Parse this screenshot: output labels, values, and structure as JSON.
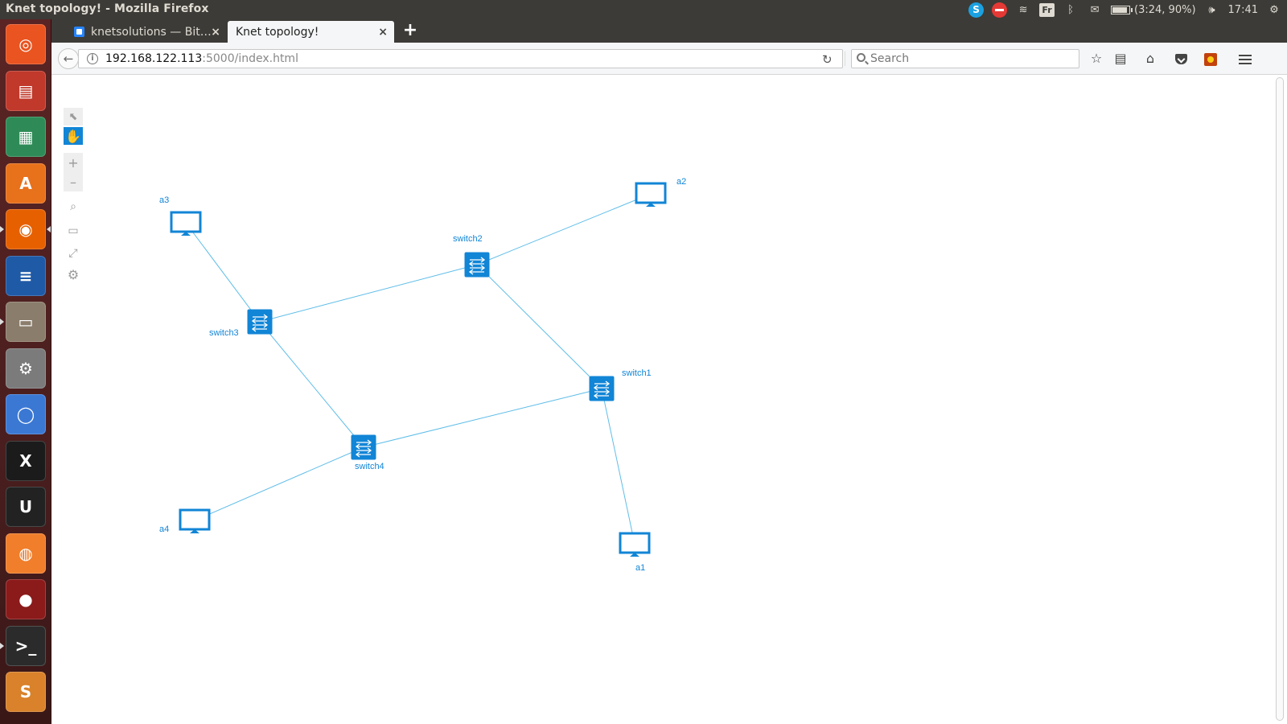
{
  "os_panel": {
    "window_title": "Knet topology! - Mozilla Firefox",
    "tray": {
      "skype_icon": "skype-icon",
      "keyboard_layout": "Fr",
      "battery_text": "(3:24, 90%)",
      "clock": "17:41"
    }
  },
  "launcher": {
    "items": [
      {
        "name": "ubuntu-dash-icon",
        "color": "#e95420",
        "glyph": "◎"
      },
      {
        "name": "impress-icon",
        "color": "#c0392b",
        "glyph": "▤"
      },
      {
        "name": "calc-icon",
        "color": "#2e8b57",
        "glyph": "▦"
      },
      {
        "name": "software-center-icon",
        "color": "#e8711b",
        "glyph": "A"
      },
      {
        "name": "firefox-icon",
        "color": "#e66000",
        "glyph": "◉"
      },
      {
        "name": "writer-icon",
        "color": "#1f5aa6",
        "glyph": "≡"
      },
      {
        "name": "files-icon",
        "color": "#8a7d6b",
        "glyph": "▭"
      },
      {
        "name": "system-settings-icon",
        "color": "#7b7b7b",
        "glyph": "⚙"
      },
      {
        "name": "chromium-icon",
        "color": "#3b78d4",
        "glyph": "◯"
      },
      {
        "name": "xchat-icon",
        "color": "#1b1b1b",
        "glyph": "X"
      },
      {
        "name": "uble-icon",
        "color": "#222222",
        "glyph": "U"
      },
      {
        "name": "blender-icon",
        "color": "#f07e2b",
        "glyph": "◍"
      },
      {
        "name": "red-app-icon",
        "color": "#8b1a1a",
        "glyph": "●"
      },
      {
        "name": "terminal-icon",
        "color": "#2b2b2b",
        "glyph": ">_"
      },
      {
        "name": "sublime-icon",
        "color": "#d9822b",
        "glyph": "S"
      }
    ]
  },
  "browser": {
    "tabs": [
      {
        "label": "knetsolutions — Bit…",
        "active": false
      },
      {
        "label": "Knet topology!",
        "active": true
      }
    ],
    "url_host": "192.168.122.113",
    "url_rest": ":5000/index.html",
    "search_placeholder": "Search"
  },
  "topology": {
    "toolbar": [
      "select-tool-icon",
      "pan-tool-icon",
      "zoom-in-icon",
      "zoom-out-icon",
      "zoom-by-selection-icon",
      "fit-to-screen-icon",
      "fullscreen-icon",
      "settings-gear-icon"
    ],
    "colors": {
      "node": "#1185d6",
      "link": "#5fbde8"
    },
    "nodes": [
      {
        "id": "switch1",
        "type": "switch",
        "label": "switch1"
      },
      {
        "id": "switch2",
        "type": "switch",
        "label": "switch2"
      },
      {
        "id": "switch3",
        "type": "switch",
        "label": "switch3"
      },
      {
        "id": "switch4",
        "type": "switch",
        "label": "switch4"
      },
      {
        "id": "a1",
        "type": "host",
        "label": "a1"
      },
      {
        "id": "a2",
        "type": "host",
        "label": "a2"
      },
      {
        "id": "a3",
        "type": "host",
        "label": "a3"
      },
      {
        "id": "a4",
        "type": "host",
        "label": "a4"
      }
    ],
    "links": [
      [
        "a3",
        "switch3"
      ],
      [
        "switch3",
        "switch2"
      ],
      [
        "switch2",
        "a2"
      ],
      [
        "switch2",
        "switch1"
      ],
      [
        "switch3",
        "switch4"
      ],
      [
        "switch4",
        "switch1"
      ],
      [
        "switch4",
        "a4"
      ],
      [
        "switch1",
        "a1"
      ]
    ]
  }
}
